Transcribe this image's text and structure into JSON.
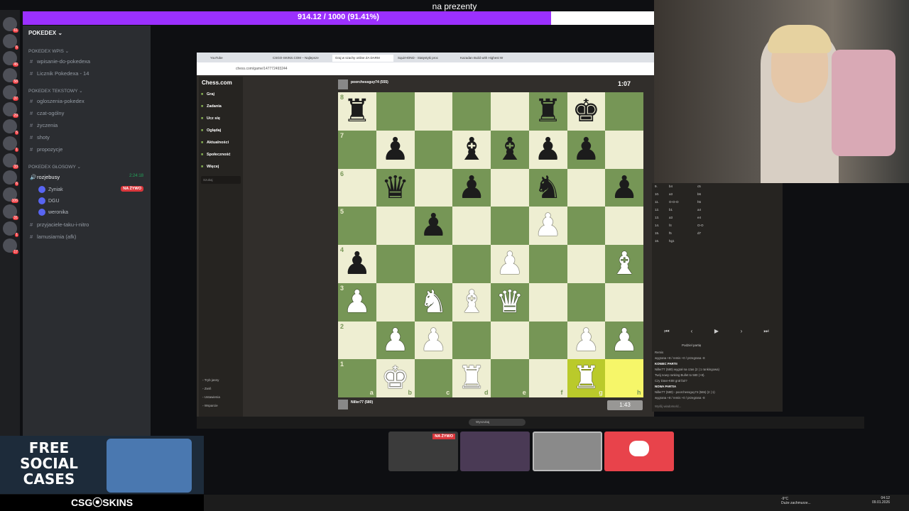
{
  "goal": {
    "title": "na prezenty",
    "progress_text": "914.12 / 1000 (91.41%)",
    "fraction": 0.9141,
    "colors": {
      "fill": "#9b30ff",
      "empty": "#ffffff"
    }
  },
  "discord": {
    "guild_name": "POKEDEX",
    "categories": [
      {
        "name": "POKEDEX Wpis",
        "channels": [
          "wpisanie-do-pokedexa",
          "Licznik Pokedexa - 14"
        ]
      },
      {
        "name": "POKEDEX Tekstowy",
        "channels": [
          "ogloszenia-pokedex",
          "czat-ogólny",
          "życzenia",
          "shoty",
          "propozycje"
        ]
      },
      {
        "name": "POKEDEX GŁOSOWY",
        "channels": [
          "rozjebusy",
          "przyjaciele-taku-i-nitro",
          "lamusiarnia (afk)"
        ]
      }
    ],
    "voice_time": "2:24:18",
    "voice_users": [
      "Zyniak",
      "DGU",
      "weronika"
    ],
    "live_label": "NA ŻYWO",
    "server_badges": [
      "61",
      "5",
      "45",
      "58",
      "37",
      "29",
      "5",
      "1",
      "33",
      "6",
      "106",
      "31",
      "1",
      "17"
    ]
  },
  "browser": {
    "tabs": [
      "YouTube",
      "CSGO-SKINS.COM – Najlepsze",
      "Graj w szachy online ZA DARM",
      "SquirHOND - Statystyki proc",
      "Kazadan Build with Highest W"
    ],
    "url": "chess.com/game/147772493244"
  },
  "chess": {
    "logo": "Chess.com",
    "nav": [
      "Graj",
      "Zadania",
      "Ucz się",
      "Oglądaj",
      "Aktualności",
      "Społeczność",
      "Więcej"
    ],
    "search_placeholder": "Szukaj",
    "footer": [
      "Tryb jasny",
      "Zwiń",
      "Ustawienia",
      "Wsparcie"
    ],
    "opponent": "poorchessguy74 (555)",
    "opponent_clock": "1:07",
    "player": "Niller77 (580)",
    "player_clock": "1:43",
    "files": [
      "a",
      "b",
      "c",
      "d",
      "e",
      "f",
      "g",
      "h"
    ],
    "ranks": [
      "8",
      "7",
      "6",
      "5",
      "4",
      "3",
      "2",
      "1"
    ],
    "position": [
      [
        "bR",
        "",
        "",
        "",
        "",
        "bR",
        "bK",
        ""
      ],
      [
        "",
        "bP",
        "",
        "bB",
        "bB",
        "bP",
        "bP",
        ""
      ],
      [
        "",
        "bQ",
        "",
        "bP",
        "",
        "bN",
        "",
        "bP"
      ],
      [
        "",
        "",
        "bP",
        "",
        "",
        "wP",
        "",
        ""
      ],
      [
        "bP",
        "",
        "",
        "",
        "wP",
        "",
        "",
        "wB"
      ],
      [
        "wP",
        "",
        "wN",
        "wB",
        "wQ",
        "",
        "",
        ""
      ],
      [
        "",
        "wP",
        "wP",
        "",
        "",
        "",
        "wP",
        "wP"
      ],
      [
        "",
        "wK",
        "",
        "wR",
        "",
        "",
        "wR",
        ""
      ]
    ],
    "moves": [
      {
        "n": "9.",
        "w": "b4",
        "b": "c5"
      },
      {
        "n": "10.",
        "w": "a3",
        "b": "b6"
      },
      {
        "n": "11.",
        "w": "O-O-O",
        "b": "h5"
      },
      {
        "n": "12.",
        "w": "b1",
        "b": "a4"
      },
      {
        "n": "13.",
        "w": "a3",
        "b": "e4"
      },
      {
        "n": "14.",
        "w": "f4",
        "b": "O-O"
      },
      {
        "n": "15.",
        "w": "f5",
        "b": "d7"
      },
      {
        "n": "16.",
        "w": "hg1",
        "b": ""
      }
    ],
    "log": [
      {
        "t": "Remis",
        "bold": false
      },
      {
        "t": "wygrana +8 / remis +0 / przegrana -8",
        "bold": false
      },
      {
        "t": "KONIEC PARTII",
        "bold": true
      },
      {
        "t": "Niller77 (580) wygrał na czas (2 | 1 rankingowa)",
        "bold": false
      },
      {
        "t": "Twój nowy ranking Bullet to 580 (+8).",
        "bold": false
      },
      {
        "t": "Czy Dave-K88 grał fair?",
        "bold": false
      },
      {
        "t": "NOWA PARTIA",
        "bold": true
      },
      {
        "t": "Niller77 (580) - poorchessguy74 (565) (2 | 1)",
        "bold": false
      },
      {
        "t": "wygrana +8 / remis +0 / przegrana -8",
        "bold": false
      }
    ],
    "share_label": "Podziel partię",
    "chat_placeholder": "Wyślij wiadomość...",
    "colors": {
      "light": "#eeeed2",
      "dark": "#769656",
      "highlight": "#f6f669"
    }
  },
  "windows": {
    "search_placeholder": "Wyszukaj",
    "weather": "-9°C",
    "weather_desc": "Duże zachmurze...",
    "time": "04:12",
    "date": "09.01.2026"
  },
  "promo": {
    "headline": "FREE SOCIAL CASES",
    "brand": "CSG⦿SKINS"
  },
  "thumbs": {
    "live_label": "NA ŻYWO"
  }
}
